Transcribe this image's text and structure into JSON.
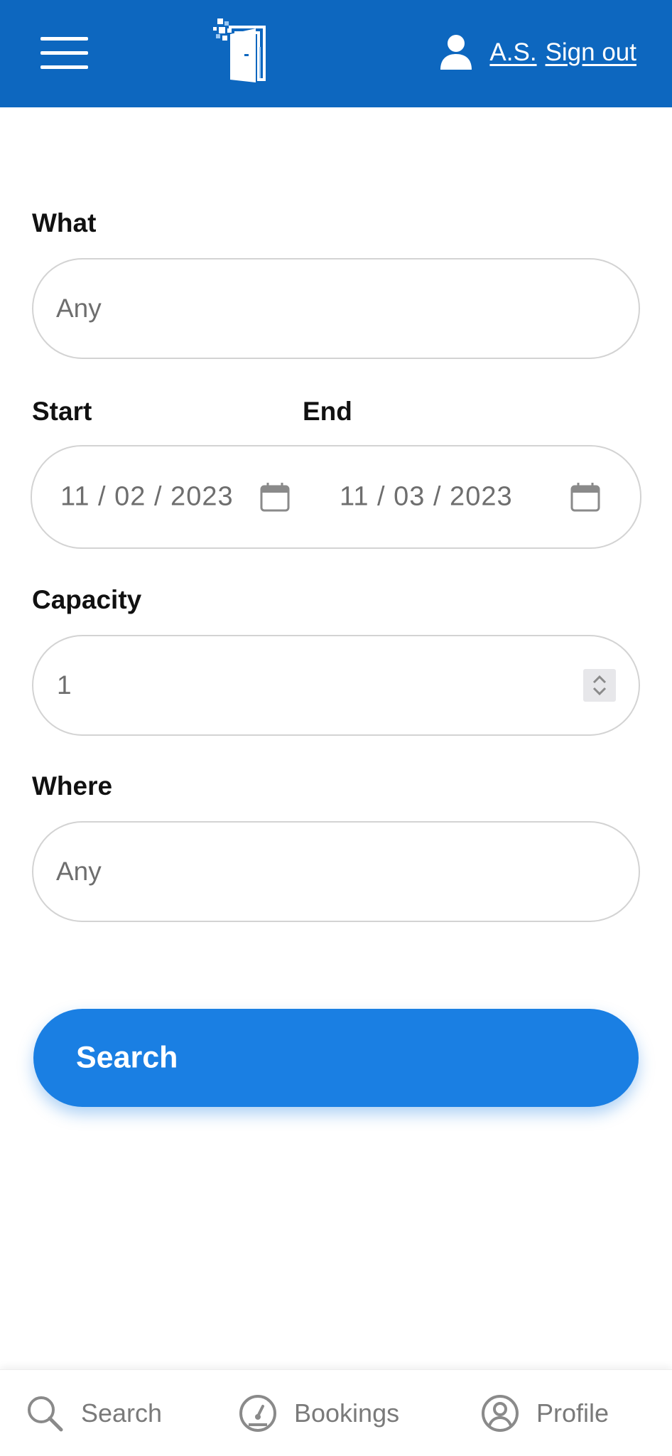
{
  "header": {
    "user_initials": "A.S.",
    "sign_out_label": "Sign out",
    "brand_color": "#0d67bf",
    "menu_icon": "hamburger-icon",
    "logo_icon": "door-logo-icon",
    "user_icon": "user-icon"
  },
  "form": {
    "what": {
      "label": "What",
      "placeholder": "Any"
    },
    "start": {
      "label": "Start",
      "value": "11 / 02 / 2023"
    },
    "end": {
      "label": "End",
      "value": "11 / 03 / 2023"
    },
    "capacity": {
      "label": "Capacity",
      "value": "1"
    },
    "where": {
      "label": "Where",
      "placeholder": "Any"
    },
    "search_label": "Search",
    "search_color": "#1a7fe3"
  },
  "bottom_nav": {
    "items": [
      {
        "label": "Search",
        "icon": "search-icon"
      },
      {
        "label": "Bookings",
        "icon": "gauge-icon"
      },
      {
        "label": "Profile",
        "icon": "profile-icon"
      }
    ]
  }
}
